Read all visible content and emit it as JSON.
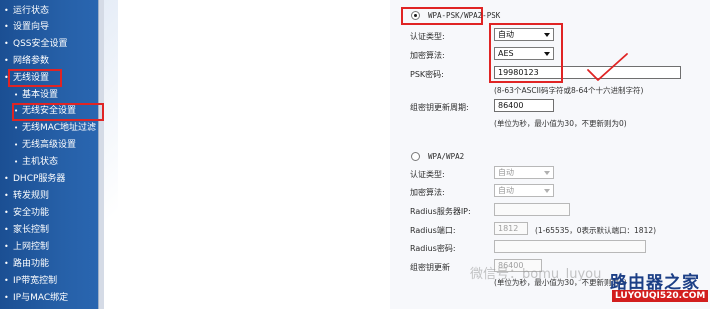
{
  "sidebar": {
    "items": [
      {
        "label": "运行状态"
      },
      {
        "label": "设置向导"
      },
      {
        "label": "QSS安全设置"
      },
      {
        "label": "网络参数"
      },
      {
        "label": "无线设置"
      },
      {
        "label": "基本设置"
      },
      {
        "label": "无线安全设置"
      },
      {
        "label": "无线MAC地址过滤"
      },
      {
        "label": "无线高级设置"
      },
      {
        "label": "主机状态"
      },
      {
        "label": "DHCP服务器"
      },
      {
        "label": "转发规则"
      },
      {
        "label": "安全功能"
      },
      {
        "label": "家长控制"
      },
      {
        "label": "上网控制"
      },
      {
        "label": "路由功能"
      },
      {
        "label": "IP带宽控制"
      },
      {
        "label": "IP与MAC绑定"
      }
    ],
    "bullet": "•"
  },
  "wpa_psk": {
    "radio_label": "WPA-PSK/WPA2-PSK",
    "auth_type_label": "认证类型:",
    "auth_type_value": "自动",
    "encrypt_label": "加密算法:",
    "encrypt_value": "AES",
    "psk_label": "PSK密码:",
    "psk_value": "19980123",
    "psk_hint": "(8-63个ASCII码字符或8-64个十六进制字符)",
    "renew_label": "组密钥更新周期:",
    "renew_value": "86400",
    "renew_hint": "(单位为秒，最小值为30，不更新则为0)"
  },
  "wpa": {
    "radio_label": "WPA/WPA2",
    "auth_type_label": "认证类型:",
    "auth_type_value": "自动",
    "encrypt_label": "加密算法:",
    "encrypt_value": "自动",
    "radius_ip_label": "Radius服务器IP:",
    "radius_port_label": "Radius端口:",
    "radius_port_value": "1812",
    "radius_port_hint": "(1-65535，0表示默认端口：1812)",
    "radius_pwd_label": "Radius密码:",
    "renew_label": "组密钥更新",
    "renew_value": "86400",
    "renew_hint": "(单位为秒，最小值为30，不更新则为0)"
  },
  "watermark": "微信号：bomu_luyou",
  "logo": {
    "title": "路由器之家",
    "url": "LUYOUQI520.COM"
  },
  "colors": {
    "sidebar": "#2660a8",
    "highlight": "#e02424",
    "logo_blue": "#1c3f86"
  }
}
